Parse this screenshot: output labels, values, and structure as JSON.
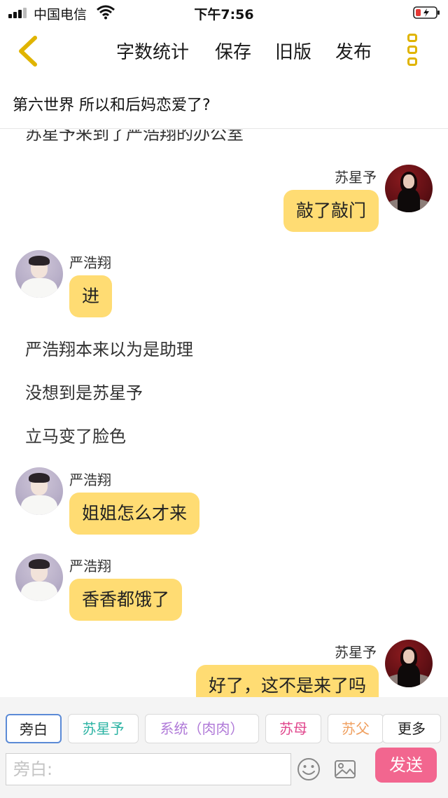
{
  "status_bar": {
    "carrier": "中国电信",
    "time": "下午7:56"
  },
  "nav": {
    "actions": [
      "字数统计",
      "保存",
      "旧版",
      "发布"
    ],
    "accent_color": "#e0b400"
  },
  "chapter_title": "第六世界  所以和后妈恋爱了?",
  "chat": {
    "partial_top_line": "苏星予来到了严浩翔的办公室",
    "entries": [
      {
        "type": "message",
        "side": "right",
        "speaker": "苏星予",
        "text": "敲了敲门"
      },
      {
        "type": "message",
        "side": "left",
        "speaker": "严浩翔",
        "text": "进"
      },
      {
        "type": "narration",
        "text": "严浩翔本来以为是助理"
      },
      {
        "type": "narration",
        "text": "没想到是苏星予"
      },
      {
        "type": "narration",
        "text": "立马变了脸色"
      },
      {
        "type": "message",
        "side": "left",
        "speaker": "严浩翔",
        "text": "姐姐怎么才来"
      },
      {
        "type": "message",
        "side": "left",
        "speaker": "严浩翔",
        "text": "香香都饿了"
      },
      {
        "type": "message",
        "side": "right",
        "speaker": "苏星予",
        "text": "好了，这不是来了吗"
      }
    ],
    "bubble_color": "#ffdc73"
  },
  "toolbar": {
    "roles": [
      {
        "label": "旁白",
        "color": "#222222",
        "active": true
      },
      {
        "label": "苏星予",
        "color": "#2bb3a3",
        "active": false
      },
      {
        "label": "系统（肉肉）",
        "color": "#b07ad8",
        "active": false
      },
      {
        "label": "苏母",
        "color": "#e0468c",
        "active": false
      },
      {
        "label": "苏父",
        "color": "#f0a060",
        "active": false
      },
      {
        "label": "更多",
        "color": "#222222",
        "active": false
      }
    ],
    "input_placeholder": "旁白:",
    "input_value": "",
    "send_label": "发送",
    "send_color": "#f2668f"
  },
  "icons": [
    "signal-icon",
    "wifi-icon",
    "battery-icon",
    "back-icon",
    "more-icon",
    "emoji-icon",
    "image-icon"
  ]
}
